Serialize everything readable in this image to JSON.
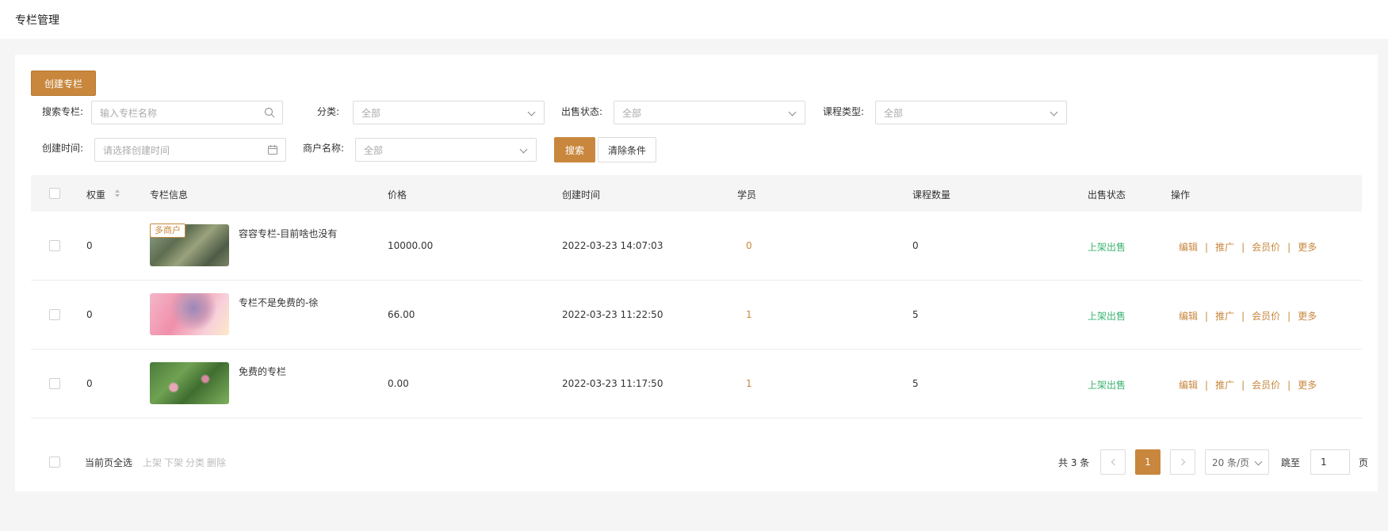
{
  "header": {
    "title": "专栏管理"
  },
  "toolbar": {
    "create_label": "创建专栏"
  },
  "filters": {
    "search_label": "搜索专栏:",
    "search_placeholder": "输入专栏名称",
    "category_label": "分类:",
    "category_value": "全部",
    "sale_status_label": "出售状态:",
    "sale_status_value": "全部",
    "course_type_label": "课程类型:",
    "course_type_value": "全部",
    "created_time_label": "创建时间:",
    "created_time_placeholder": "请选择创建时间",
    "merchant_label": "商户名称:",
    "merchant_value": "全部",
    "search_button": "搜索",
    "clear_button": "清除条件"
  },
  "table": {
    "headers": {
      "weight": "权重",
      "info": "专栏信息",
      "price": "价格",
      "created": "创建时间",
      "students": "学员",
      "course_count": "课程数量",
      "status": "出售状态",
      "actions": "操作"
    },
    "rows": [
      {
        "weight": "0",
        "tag": "多商户",
        "name": "容容专栏-目前啥也没有",
        "price": "10000.00",
        "created": "2022-03-23 14:07:03",
        "students": "0",
        "course_count": "0",
        "status": "上架出售"
      },
      {
        "weight": "0",
        "name": "专栏不是免费的-徐",
        "price": "66.00",
        "created": "2022-03-23 11:22:50",
        "students": "1",
        "course_count": "5",
        "status": "上架出售"
      },
      {
        "weight": "0",
        "name": "免费的专栏",
        "price": "0.00",
        "created": "2022-03-23 11:17:50",
        "students": "1",
        "course_count": "5",
        "status": "上架出售"
      }
    ],
    "actions": {
      "edit": "编辑",
      "promote": "推广",
      "member_price": "会员价",
      "more": "更多"
    }
  },
  "bulk": {
    "select_all": "当前页全选",
    "list_on": "上架",
    "list_off": "下架",
    "category": "分类",
    "delete": "删除"
  },
  "pagination": {
    "total": "共 3 条",
    "current_page": "1",
    "page_size": "20 条/页",
    "jump_label": "跳至",
    "jump_value": "1",
    "page_suffix": "页"
  },
  "colors": {
    "accent": "#c8873d",
    "status_green": "#3cb371"
  }
}
